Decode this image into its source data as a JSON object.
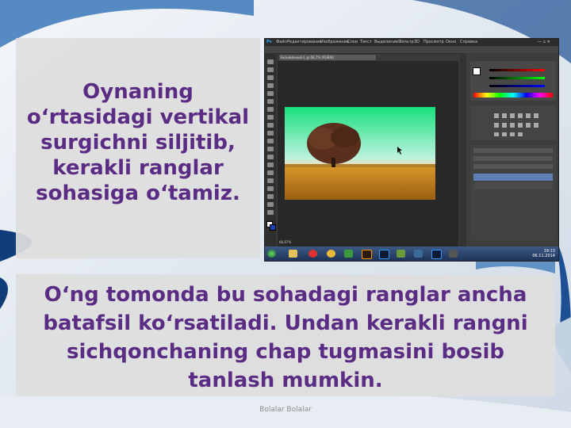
{
  "slide": {
    "text_left": "Oynaning o‘rtasidagi vertikal surgichni siljitib, kerakli ranglar sohasiga o‘tamiz.",
    "text_bottom": "O‘ng tomonda bu sohadagi ranglar ancha batafsil ko‘rsatiladi. Undan kerakli rangni sichqonchaning chap tugmasini bosib tanlash mumkin.",
    "footer": "Bolalar Bolalar"
  },
  "photoshop": {
    "menu": [
      "Ps",
      "Файл",
      "Редактирование",
      "Изображение",
      "Слои",
      "Текст",
      "Выделение",
      "Фильтр",
      "3D",
      "Просмотр",
      "Окно",
      "Справка"
    ],
    "document_tab": "Безымянный-1 @ 66,7% (RGB/8)",
    "status_zoom": "66,67%",
    "clock_time": "19:13",
    "clock_date": "06.11.2014"
  },
  "colors": {
    "title_purple": "#5b2c83",
    "panel_gray": "#dedede",
    "photo_sky_top": "#18e07e",
    "photo_field": "#c8861e"
  }
}
